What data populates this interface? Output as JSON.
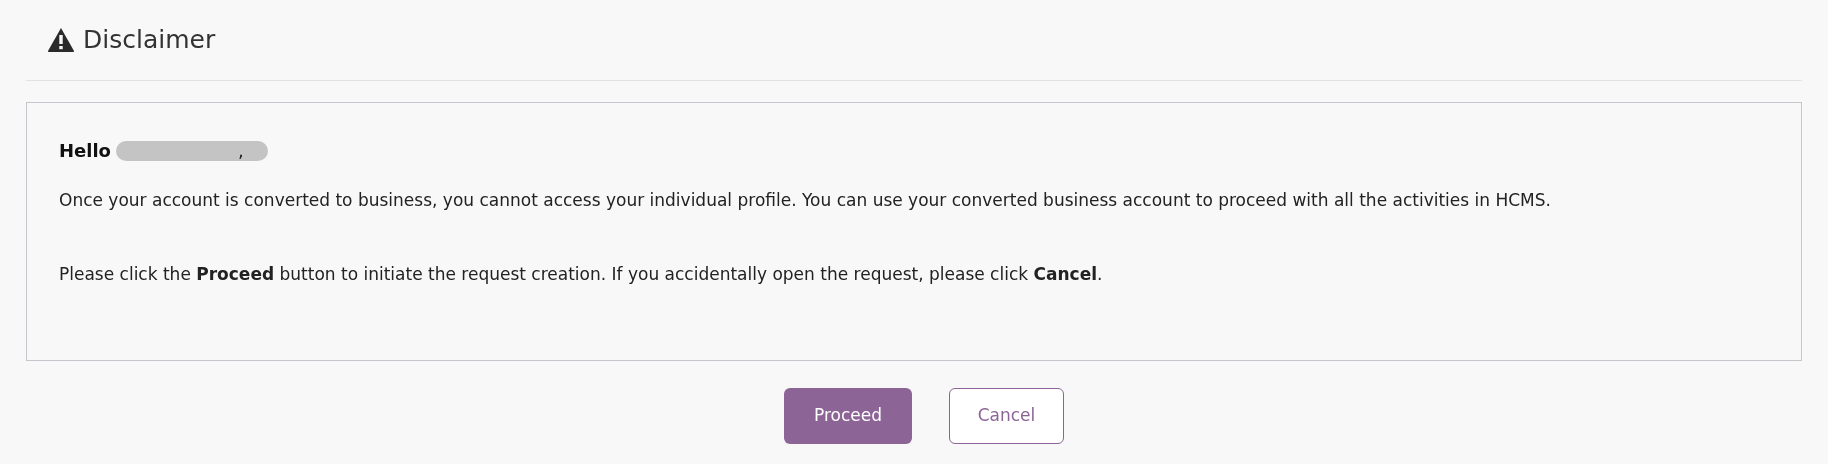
{
  "dialog": {
    "title": "Disclaimer"
  },
  "message": {
    "greeting": "Hello",
    "greeting_end": ",",
    "paragraphs": [
      "Once your account is converted to business, you cannot access your individual profile. You can use your converted business account to proceed with all the activities in HCMS.",
      "Please click the **Proceed** button to initiate the request creation. If you accidentally open the request, please click **Cancel**."
    ]
  },
  "buttons": [
    {
      "label": "Proceed",
      "kind": "primary"
    },
    {
      "label": "Cancel",
      "kind": "secondary"
    }
  ]
}
